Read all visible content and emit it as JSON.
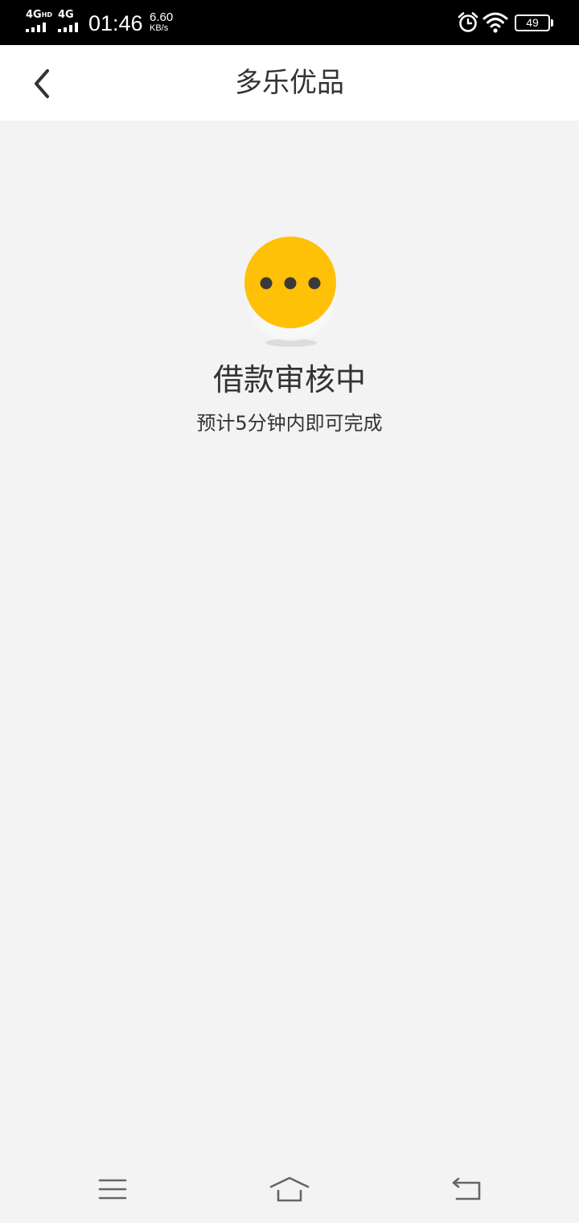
{
  "status_bar": {
    "network1": "4G",
    "network1_badge": "HD",
    "network2": "4G",
    "time": "01:46",
    "speed_value": "6.60",
    "speed_unit": "KB/s",
    "battery": "49",
    "icons": [
      "alarm-icon",
      "wifi-icon",
      "battery-icon"
    ]
  },
  "header": {
    "title": "多乐优品",
    "back_icon": "chevron-left-icon"
  },
  "main": {
    "icon": "loading-dots-icon",
    "icon_color": "#FFC107",
    "title": "借款审核中",
    "subtitle": "预计5分钟内即可完成"
  },
  "nav_bar": {
    "icons": [
      "menu-icon",
      "home-icon",
      "back-icon"
    ]
  }
}
